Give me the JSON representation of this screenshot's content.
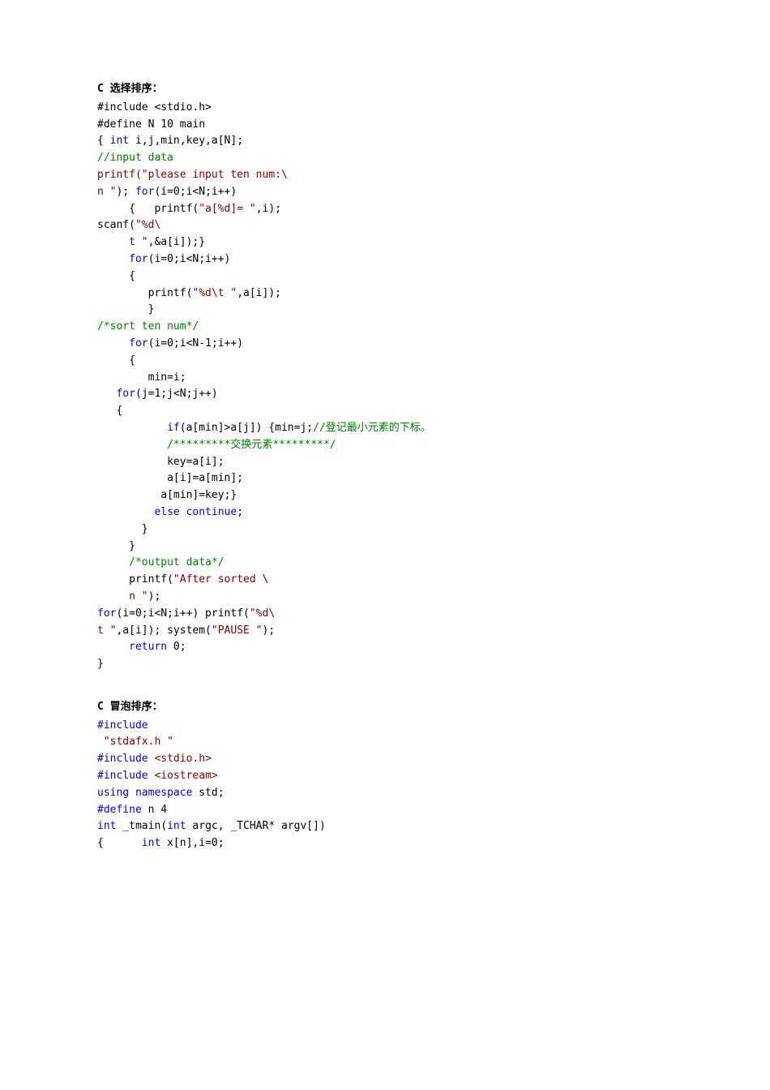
{
  "section1": {
    "title": "C 选择排序：",
    "lines": [
      {
        "t": "#include <stdio.h>",
        "class": "black"
      },
      {
        "t": "#define N 10 main",
        "class": "black"
      },
      {
        "segments": [
          {
            "t": "{",
            "class": "black"
          },
          {
            "t": " int",
            "class": "blue"
          },
          {
            "t": " i,j,min,key,a[N];",
            "class": "black"
          }
        ]
      },
      {
        "segments": [
          {
            "t": "//input data",
            "class": "green"
          }
        ]
      },
      {
        "segments": [
          {
            "t": "printf(\"please input ten num:\\",
            "class": "maroon"
          }
        ]
      },
      {
        "segments": [
          {
            "t": "n \"",
            "class": "maroon"
          },
          {
            "t": ");",
            "class": "black"
          },
          {
            "t": " for",
            "class": "blue"
          },
          {
            "t": "(i=0;i<N;i++)",
            "class": "black"
          }
        ]
      },
      {
        "segments": [
          {
            "t": "     {   printf(",
            "class": "black"
          },
          {
            "t": "\"a[%d]= \"",
            "class": "maroon"
          },
          {
            "t": ",i);",
            "class": "black"
          }
        ]
      },
      {
        "segments": [
          {
            "t": "scanf(",
            "class": "black"
          },
          {
            "t": "\"%d\\",
            "class": "maroon"
          }
        ]
      },
      {
        "segments": [
          {
            "t": "     t \"",
            "class": "maroon"
          },
          {
            "t": ",&a[i]);}",
            "class": "black"
          }
        ]
      },
      {
        "segments": [
          {
            "t": "     for",
            "class": "blue"
          },
          {
            "t": "(i=0;i<N;i++)",
            "class": "black"
          }
        ]
      },
      {
        "segments": [
          {
            "t": "     {",
            "class": "black"
          }
        ]
      },
      {
        "segments": [
          {
            "t": "        printf(",
            "class": "black"
          },
          {
            "t": "\"%d\\t \"",
            "class": "maroon"
          },
          {
            "t": ",a[i]);",
            "class": "black"
          }
        ]
      },
      {
        "segments": [
          {
            "t": "        }",
            "class": "black"
          }
        ]
      },
      {
        "segments": [
          {
            "t": "/*sort ten num*/",
            "class": "green"
          }
        ]
      },
      {
        "segments": [
          {
            "t": "     for",
            "class": "blue"
          },
          {
            "t": "(i=0;i<N-1;i++)",
            "class": "black"
          }
        ]
      },
      {
        "segments": [
          {
            "t": "     {",
            "class": "black"
          }
        ]
      },
      {
        "segments": [
          {
            "t": "        min=i;",
            "class": "black"
          }
        ]
      },
      {
        "segments": [
          {
            "t": "   for",
            "class": "blue"
          },
          {
            "t": "(j=1;j<N;j++)",
            "class": "black"
          }
        ]
      },
      {
        "segments": [
          {
            "t": "   {",
            "class": "black"
          }
        ]
      },
      {
        "segments": [
          {
            "t": "           if",
            "class": "blue"
          },
          {
            "t": "(a[min]>a[j]) {min=j;",
            "class": "black"
          },
          {
            "t": "//登记最小元素的下标。",
            "class": "green"
          }
        ]
      },
      {
        "segments": [
          {
            "t": "           /*********交换元素*********/",
            "class": "green"
          }
        ]
      },
      {
        "segments": [
          {
            "t": "           key=a[i];",
            "class": "black"
          }
        ]
      },
      {
        "segments": [
          {
            "t": "           a[i]=a[min];",
            "class": "black"
          }
        ]
      },
      {
        "segments": [
          {
            "t": "          a[min]=key;}",
            "class": "black"
          }
        ]
      },
      {
        "segments": [
          {
            "t": "         else",
            "class": "blue"
          },
          {
            "t": " continue",
            "class": "blue"
          },
          {
            "t": ";",
            "class": "black"
          }
        ]
      },
      {
        "segments": [
          {
            "t": "       }",
            "class": "black"
          }
        ]
      },
      {
        "segments": [
          {
            "t": "     }",
            "class": "black"
          }
        ]
      },
      {
        "segments": [
          {
            "t": "     /*output data*/",
            "class": "green"
          }
        ]
      },
      {
        "segments": [
          {
            "t": "     printf(",
            "class": "black"
          },
          {
            "t": "\"After sorted \\",
            "class": "maroon"
          }
        ]
      },
      {
        "segments": [
          {
            "t": "     n \"",
            "class": "maroon"
          },
          {
            "t": ");",
            "class": "black"
          }
        ]
      },
      {
        "segments": [
          {
            "t": "for",
            "class": "blue"
          },
          {
            "t": "(i=0;i<N;i++) printf(",
            "class": "black"
          },
          {
            "t": "\"%d\\",
            "class": "maroon"
          }
        ]
      },
      {
        "segments": [
          {
            "t": "t \"",
            "class": "maroon"
          },
          {
            "t": ",a[i]); system(",
            "class": "black"
          },
          {
            "t": "\"PAUSE \"",
            "class": "maroon"
          },
          {
            "t": ");",
            "class": "black"
          }
        ]
      },
      {
        "segments": [
          {
            "t": "     return",
            "class": "blue"
          },
          {
            "t": " 0;",
            "class": "black"
          }
        ]
      },
      {
        "segments": [
          {
            "t": "}",
            "class": "black"
          }
        ]
      }
    ]
  },
  "section2": {
    "title": "C 冒泡排序：",
    "lines": [
      {
        "segments": [
          {
            "t": "#include",
            "class": "blue"
          }
        ]
      },
      {
        "segments": [
          {
            "t": " \"stdafx.h \"",
            "class": "maroon"
          }
        ]
      },
      {
        "segments": [
          {
            "t": "#include",
            "class": "blue"
          },
          {
            "t": " <stdio.h>",
            "class": "maroon"
          }
        ]
      },
      {
        "segments": [
          {
            "t": "#include",
            "class": "blue"
          },
          {
            "t": " <iostream>",
            "class": "maroon"
          }
        ]
      },
      {
        "segments": [
          {
            "t": "using",
            "class": "blue"
          },
          {
            "t": " namespace",
            "class": "blue"
          },
          {
            "t": " std;",
            "class": "black"
          }
        ]
      },
      {
        "segments": [
          {
            "t": "#define",
            "class": "blue"
          },
          {
            "t": " n 4",
            "class": "black"
          }
        ]
      },
      {
        "segments": [
          {
            "t": "int",
            "class": "blue"
          },
          {
            "t": " _tmain(",
            "class": "black"
          },
          {
            "t": "int",
            "class": "blue"
          },
          {
            "t": " argc, _TCHAR* argv[])",
            "class": "black"
          }
        ]
      },
      {
        "segments": [
          {
            "t": "{      ",
            "class": "black"
          },
          {
            "t": "int",
            "class": "blue"
          },
          {
            "t": " x[n],i=0;",
            "class": "black"
          }
        ]
      }
    ]
  }
}
